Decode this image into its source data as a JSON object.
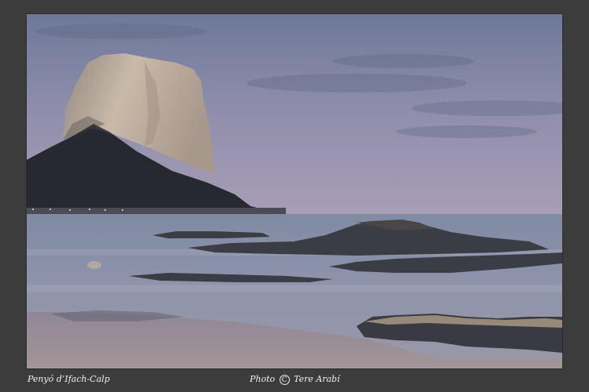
{
  "photo": {
    "subject": "Penyó d'Ifach-Calp"
  },
  "captions": {
    "location": "Penyó d’Ifach-Calp",
    "credit_prefix": "Photo",
    "copyright_symbol": "C",
    "author": "Tere Arabí"
  },
  "colors": {
    "mat": "#3c3c3c",
    "sky_top": "#6f7a9a",
    "sky_bottom": "#a69ab4",
    "sea": "#8c93a8",
    "rock": "#b8aa9c",
    "shore": "#9a8e90"
  }
}
